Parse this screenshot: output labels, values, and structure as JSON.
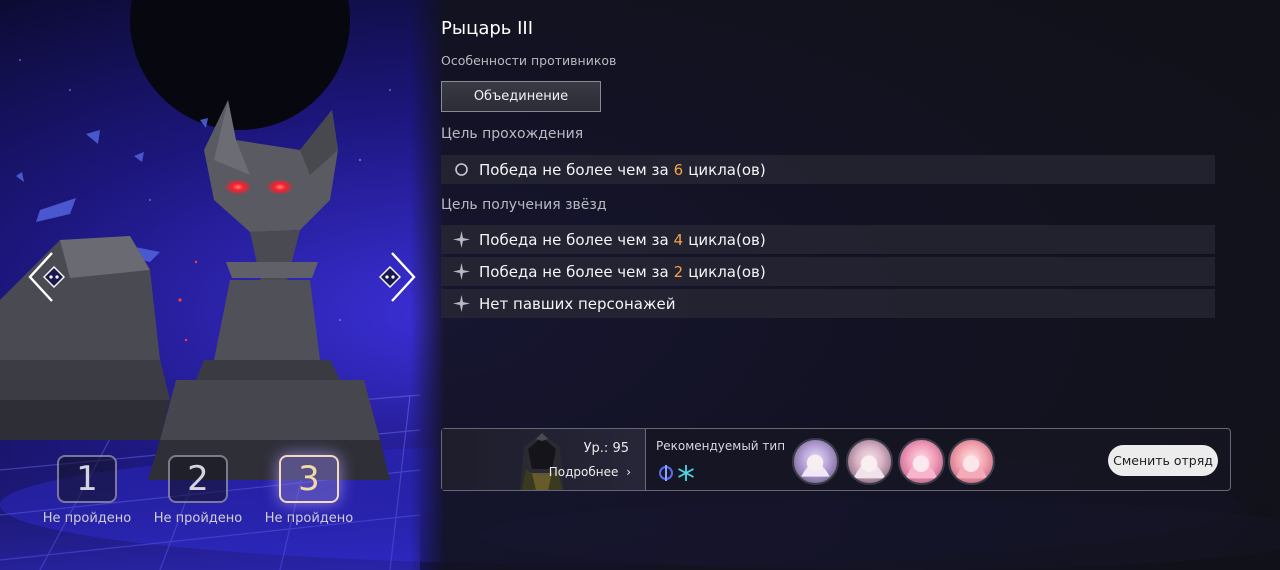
{
  "stage_title": "Рыцарь III",
  "enemy_features": {
    "label": "Особенности противников",
    "feature_button": "Объединение"
  },
  "completion_goal": {
    "label": "Цель прохождения",
    "prefix": "Победа не более чем за",
    "number": "6",
    "suffix": "цикла(ов)"
  },
  "star_goals": {
    "label": "Цель получения звёзд",
    "items": [
      {
        "prefix": "Победа не более чем за",
        "number": "4",
        "suffix": "цикла(ов)"
      },
      {
        "prefix": "Победа не более чем за",
        "number": "2",
        "suffix": "цикла(ов)"
      },
      {
        "text": "Нет павших персонажей"
      }
    ]
  },
  "stages": [
    {
      "number": "1",
      "status": "Не пройдено",
      "active": false
    },
    {
      "number": "2",
      "status": "Не пройдено",
      "active": false
    },
    {
      "number": "3",
      "status": "Не пройдено",
      "active": true
    }
  ],
  "team_bar": {
    "boss_level": "Ур.: 95",
    "details_link": "Подробнее",
    "recommended_label": "Рекомендуемый тип",
    "recommended_types": [
      "quantum-icon",
      "ice-icon"
    ],
    "recommended_characters": [
      "character-avatar-1",
      "character-avatar-2",
      "character-avatar-3",
      "character-avatar-4"
    ],
    "change_team_button": "Сменить отряд"
  },
  "colors": {
    "highlight_number": "#f0a24a",
    "active_stage": "#f3d9a6",
    "scene_blue": "#3a2fd0"
  }
}
